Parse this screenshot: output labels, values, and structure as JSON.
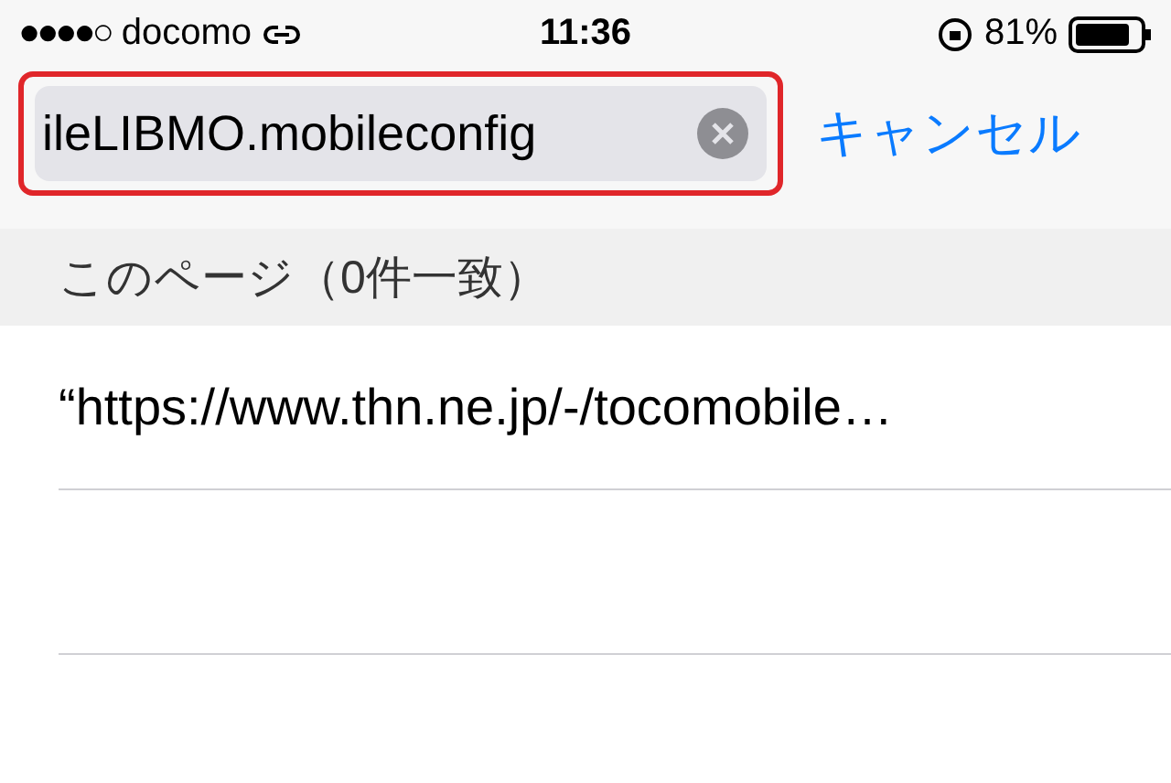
{
  "status_bar": {
    "signal": "●●●●○",
    "carrier": "docomo",
    "time": "11:36",
    "battery_percent": "81%"
  },
  "search": {
    "value": "ileLIBMO.mobileconfig",
    "highlighted": true
  },
  "cancel_button": "キャンセル",
  "section_header": "このページ（0件一致）",
  "results": [
    {
      "text": "“https://www.thn.ne.jp/-/tocomobile…"
    }
  ]
}
